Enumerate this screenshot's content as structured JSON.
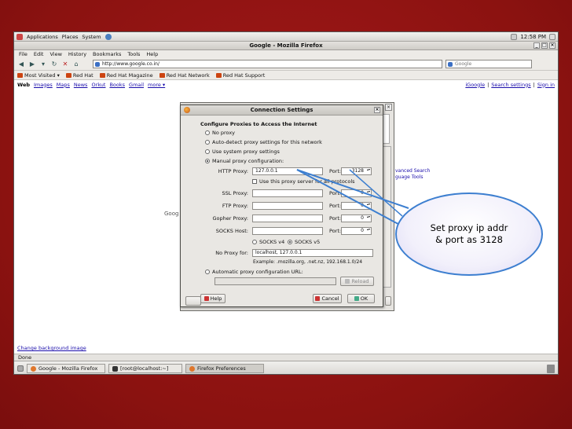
{
  "panel": {
    "menus": [
      "Applications",
      "Places",
      "System"
    ],
    "clock": "12:58 PM"
  },
  "firefox": {
    "title": "Google - Mozilla Firefox",
    "menus": [
      "File",
      "Edit",
      "View",
      "History",
      "Bookmarks",
      "Tools",
      "Help"
    ],
    "url": "http://www.google.co.in/",
    "search_placeholder": "Google",
    "bookmarks": [
      "Most Visited ▾",
      "Red Hat",
      "Red Hat Magazine",
      "Red Hat Network",
      "Red Hat Support"
    ],
    "google_links": [
      "Web",
      "Images",
      "Maps",
      "News",
      "Orkut",
      "Books",
      "Gmail",
      "more ▾"
    ],
    "google_right": [
      "iGoogle",
      "Search settings",
      "Sign in"
    ],
    "fragment_text": "Goog",
    "adv_search": "vanced Search",
    "lang_tools": "guage Tools",
    "change_bg": "Change background image",
    "status": "Done"
  },
  "taskbar": {
    "tasks": [
      "Google - Mozilla Firefox",
      "[root@localhost:~]",
      "Firefox Preferences"
    ]
  },
  "dialog": {
    "title": "Connection Settings",
    "heading": "Configure Proxies to Access the Internet",
    "options": [
      "No proxy",
      "Auto-detect proxy settings for this network",
      "Use system proxy settings",
      "Manual proxy configuration:"
    ],
    "selected_option": "Manual proxy configuration:",
    "http_label": "HTTP Proxy:",
    "http_value": "127.0.0.1",
    "port_label": "Port:",
    "http_port": "3128",
    "same_proxy_label": "Use this proxy server for all protocols",
    "ssl_label": "SSL Proxy:",
    "ftp_label": "FTP Proxy:",
    "gopher_label": "Gopher Proxy:",
    "socks_label": "SOCKS Host:",
    "other_port": "0",
    "socks_v4": "SOCKS v4",
    "socks_v5": "SOCKS v5",
    "socks_selected": "SOCKS v5",
    "no_proxy_label": "No Proxy for:",
    "no_proxy_value": "localhost, 127.0.0.1",
    "example": "Example: .mozilla.org, .net.nz, 192.168.1.0/24",
    "auto_config": "Automatic proxy configuration URL:",
    "reload": "Reload",
    "help": "Help",
    "cancel": "Cancel",
    "ok": "OK"
  },
  "callout": {
    "line1": "Set proxy ip addr",
    "line2": "& port as 3128"
  },
  "colors": {
    "slide_bg": "#8b1210",
    "callout_border": "#3d7fd0",
    "link": "#1a0dab"
  }
}
